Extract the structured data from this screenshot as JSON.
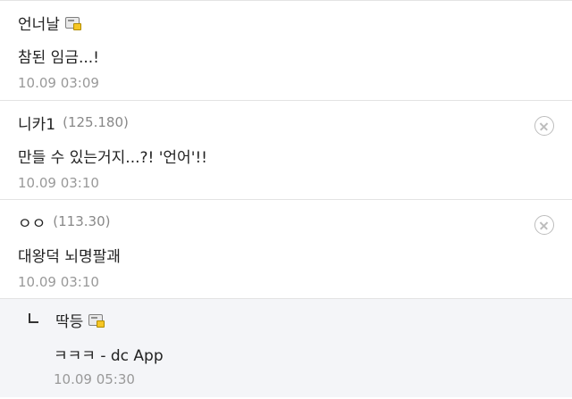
{
  "comments": [
    {
      "nick": "언너날",
      "ip": "",
      "body": "참된 임금...!",
      "date": "10.09 03:09",
      "icon": "member-icon"
    },
    {
      "nick": "니카1",
      "ip": "(125.180)",
      "body": "만들 수 있는거지...?! '언어'!!",
      "date": "10.09 03:10",
      "icon": "delete-icon"
    },
    {
      "nick": "ㅇㅇ",
      "ip": "(113.30)",
      "body": "대왕덕 뇌명팔괘",
      "date": "10.09 03:10",
      "icon": "delete-icon"
    }
  ],
  "reply": {
    "nick": "딱등",
    "body": "ㅋㅋㅋ - dc App",
    "date": "10.09 05:30",
    "icon": "member-icon"
  },
  "colors": {
    "reply_background": "#f4f5f8",
    "divider": "#e3e3e3",
    "muted_text": "#999999",
    "accent_badge": "#f6c624"
  }
}
